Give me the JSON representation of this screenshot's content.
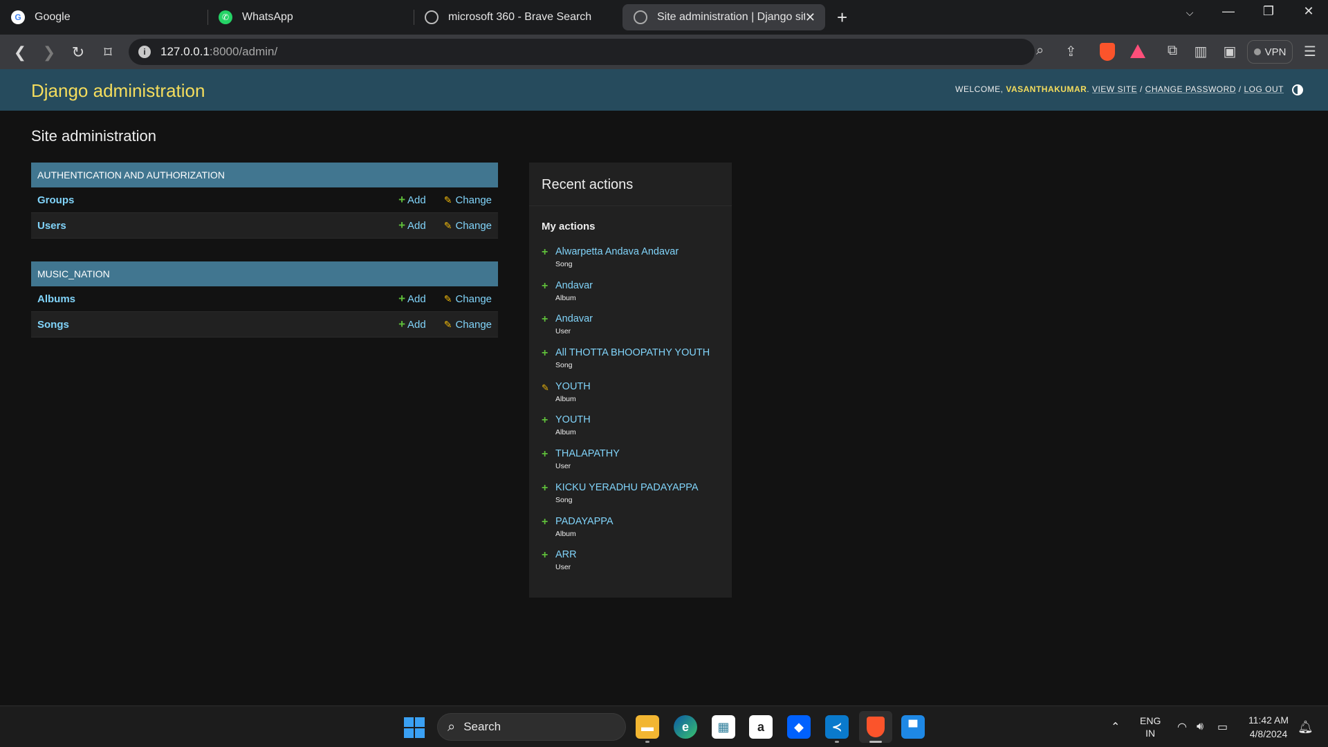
{
  "browser": {
    "tabs": [
      {
        "title": "Google",
        "icon": "google-icon"
      },
      {
        "title": "WhatsApp",
        "icon": "whatsapp-icon"
      },
      {
        "title": "microsoft 360 - Brave Search",
        "icon": "brave-search-icon"
      },
      {
        "title": "Site administration | Django site",
        "icon": "globe-icon",
        "active": true
      }
    ],
    "url_host": "127.0.0.1",
    "url_rest": ":8000/admin/",
    "vpn_label": "VPN"
  },
  "header": {
    "branding": "Django administration",
    "welcome": "WELCOME,",
    "username": "VASANTHAKUMAR",
    "view_site": "VIEW SITE",
    "change_password": "CHANGE PASSWORD",
    "log_out": "LOG OUT"
  },
  "page": {
    "title": "Site administration"
  },
  "apps": [
    {
      "caption": "Authentication and Authorization",
      "models": [
        {
          "name": "Groups",
          "add": "Add",
          "change": "Change"
        },
        {
          "name": "Users",
          "add": "Add",
          "change": "Change"
        }
      ]
    },
    {
      "caption": "MUSIC_NATION",
      "models": [
        {
          "name": "Albums",
          "add": "Add",
          "change": "Change"
        },
        {
          "name": "Songs",
          "add": "Add",
          "change": "Change"
        }
      ]
    }
  ],
  "recent_actions": {
    "title": "Recent actions",
    "subtitle": "My actions",
    "items": [
      {
        "name": "Alwarpetta Andava Andavar",
        "type": "Song",
        "action": "add"
      },
      {
        "name": "Andavar",
        "type": "Album",
        "action": "add"
      },
      {
        "name": "Andavar",
        "type": "User",
        "action": "add"
      },
      {
        "name": "All THOTTA BHOOPATHY YOUTH",
        "type": "Song",
        "action": "add"
      },
      {
        "name": "YOUTH",
        "type": "Album",
        "action": "change"
      },
      {
        "name": "YOUTH",
        "type": "Album",
        "action": "add"
      },
      {
        "name": "THALAPATHY",
        "type": "User",
        "action": "add"
      },
      {
        "name": "KICKU YERADHU PADAYAPPA",
        "type": "Song",
        "action": "add"
      },
      {
        "name": "PADAYAPPA",
        "type": "Album",
        "action": "add"
      },
      {
        "name": "ARR",
        "type": "User",
        "action": "add"
      }
    ]
  },
  "taskbar": {
    "search_label": "Search",
    "lang_top": "ENG",
    "lang_bottom": "IN",
    "time": "11:42 AM",
    "date": "4/8/2024"
  },
  "colors": {
    "header_bg": "#264b5d",
    "branding": "#f5dd5d",
    "caption_bg": "#417690",
    "link": "#81d4fa",
    "add_icon": "#5fbf3a",
    "change_icon": "#efb80b"
  }
}
